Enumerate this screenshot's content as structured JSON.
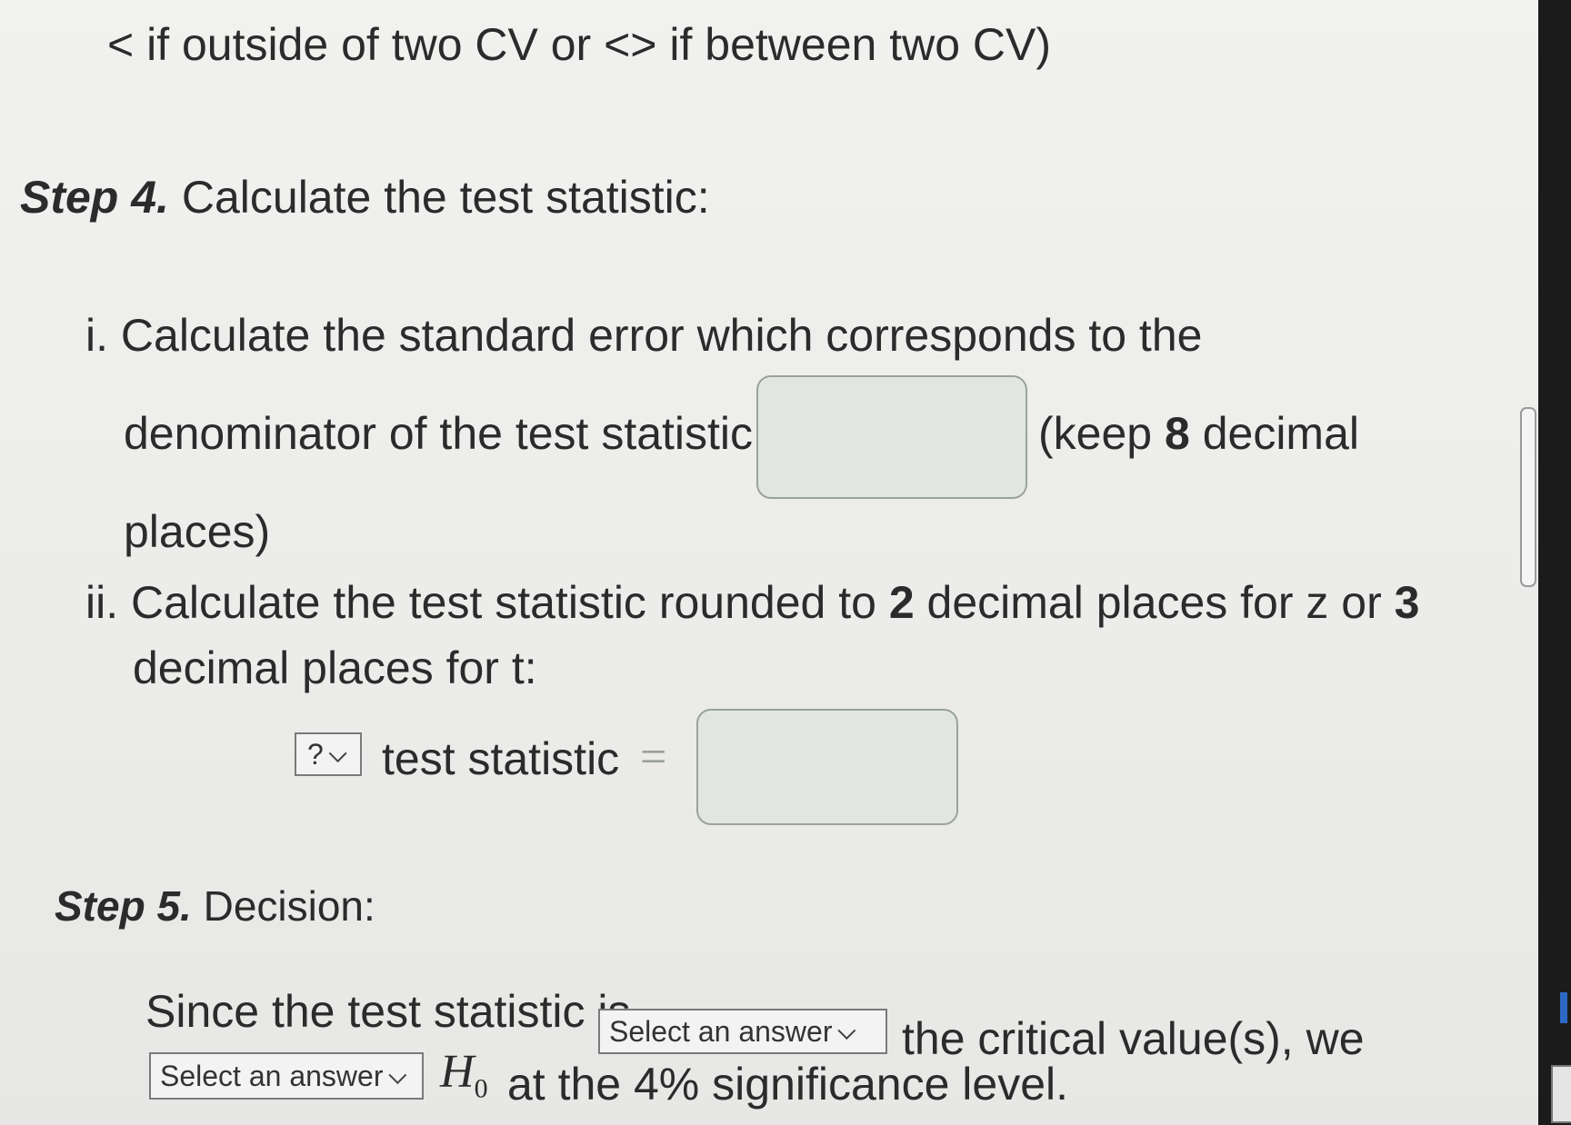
{
  "intro_line": "< if outside of two CV or <> if between two CV)",
  "step4": {
    "label": "Step 4.",
    "title": "Calculate the test statistic:",
    "item_i": {
      "marker": "i.",
      "line1": "Calculate the standard error which corresponds to the",
      "line2": "denominator of the test statistic:",
      "keep_prefix": "(keep",
      "keep_num": "8",
      "keep_suffix": "decimal",
      "line3": "places)",
      "input_value": ""
    },
    "item_ii": {
      "marker": "ii.",
      "line1_a": "Calculate the test statistic rounded to",
      "z_places": "2",
      "line1_b": "decimal places for z or",
      "t_places": "3",
      "line2": "decimal places for t:",
      "stat_type_selected": "?",
      "stat_label": "test statistic",
      "equals": "=",
      "input_value": ""
    }
  },
  "step5": {
    "label": "Step 5.",
    "title": "Decision:",
    "sentence_a": "Since the test statistic is",
    "dropdown1_selected": "Select an answer",
    "sentence_b": "the critical value(s), we",
    "dropdown2_selected": "Select an answer",
    "h0_symbol": "H",
    "h0_sub": "0",
    "sentence_c": "at the 4% significance level."
  },
  "icons": {
    "dropdown_chevron": "chevron-down-icon"
  }
}
